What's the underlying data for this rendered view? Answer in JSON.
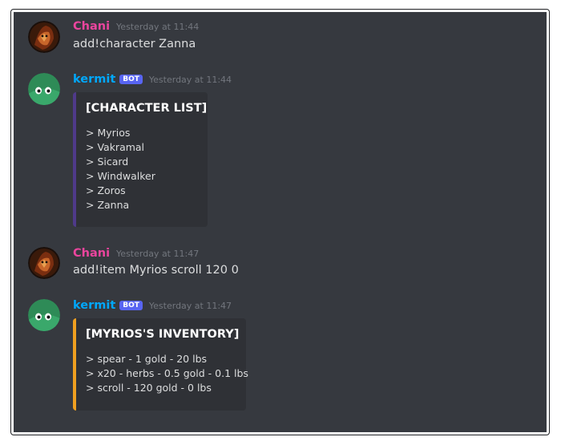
{
  "colors": {
    "chani_name": "#eb459e",
    "kermit_name": "#00a8fc",
    "embed1_accent": "#4f3a8a",
    "embed2_accent": "#f0a020",
    "bot_tag": "#5865f2"
  },
  "messages": [
    {
      "author": "Chani",
      "timestamp": "Yesterday at 11:44",
      "text": "add!character Zanna"
    },
    {
      "author": "kermit",
      "bot_tag": "BOT",
      "timestamp": "Yesterday at 11:44",
      "embed": {
        "title": "[CHARACTER LIST]",
        "lines": [
          "> Myrios",
          "> Vakramal",
          "> Sicard",
          "> Windwalker",
          "> Zoros",
          "> Zanna"
        ]
      }
    },
    {
      "author": "Chani",
      "timestamp": "Yesterday at 11:47",
      "text": "add!item Myrios scroll 120 0"
    },
    {
      "author": "kermit",
      "bot_tag": "BOT",
      "timestamp": "Yesterday at 11:47",
      "embed": {
        "title": "[MYRIOS'S INVENTORY]",
        "lines": [
          "> spear - 1 gold - 20 lbs",
          "> x20 - herbs - 0.5 gold - 0.1 lbs",
          "> scroll - 120 gold - 0 lbs"
        ]
      }
    }
  ]
}
